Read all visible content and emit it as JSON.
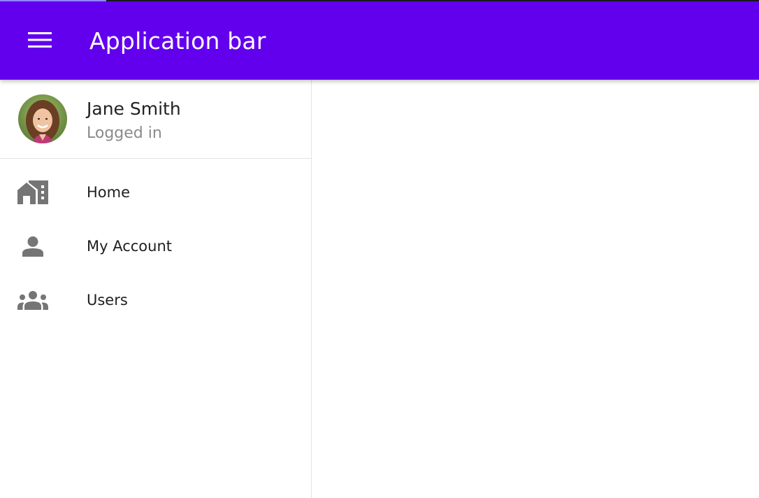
{
  "theme": {
    "primary": "#6200ee",
    "progress_fill": "#8f84ff",
    "icon_gray": "#757575"
  },
  "progress": {
    "value_fraction": 0.14
  },
  "app_bar": {
    "title": "Application bar",
    "menu_icon": "hamburger-menu-icon"
  },
  "drawer": {
    "user": {
      "name": "Jane Smith",
      "status": "Logged in",
      "avatar": "user-avatar-photo"
    },
    "items": [
      {
        "label": "Home",
        "icon": "home-work-icon"
      },
      {
        "label": "My Account",
        "icon": "person-icon"
      },
      {
        "label": "Users",
        "icon": "group-icon"
      }
    ]
  }
}
